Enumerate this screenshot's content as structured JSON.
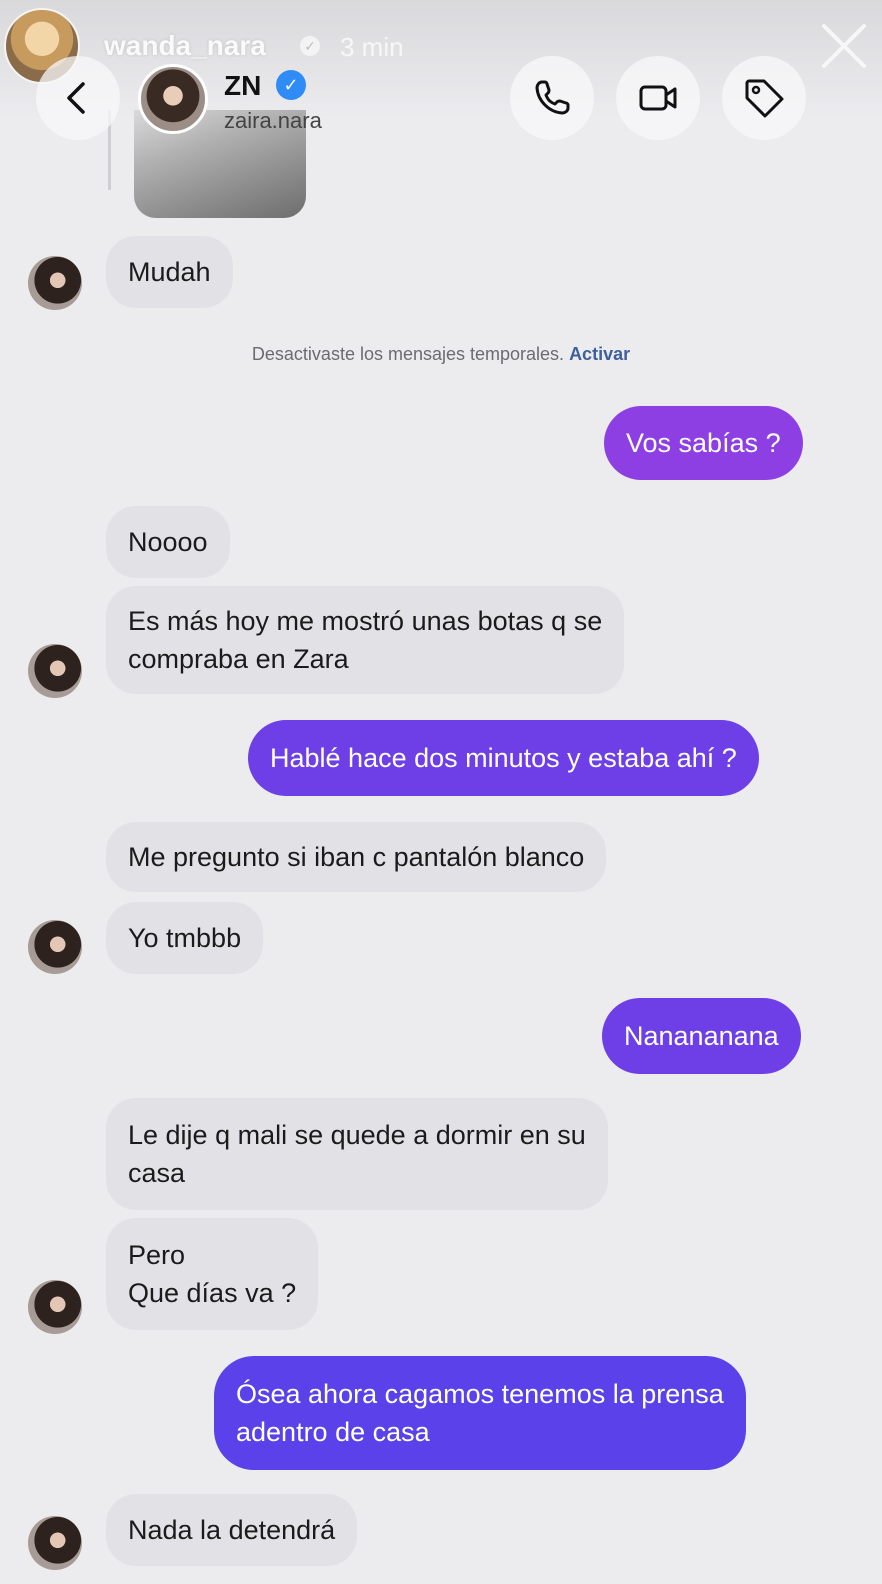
{
  "story": {
    "username": "wanda_nara",
    "time": "3 min"
  },
  "chat_header": {
    "name": "ZN",
    "username": "zaira.nara"
  },
  "system_note": {
    "text": "Desactivaste los mensajes temporales.",
    "action": "Activar"
  },
  "messages": [
    {
      "from": "them",
      "lines": [
        "Mudah"
      ]
    },
    {
      "from": "me",
      "lines": [
        "Vos sabías ?"
      ]
    },
    {
      "from": "them",
      "lines": [
        "Noooo"
      ]
    },
    {
      "from": "them",
      "lines": [
        "Es más hoy me mostró unas botas q se",
        "compraba en Zara"
      ]
    },
    {
      "from": "me",
      "lines": [
        "Hablé hace dos minutos y estaba ahí ?"
      ]
    },
    {
      "from": "them",
      "lines": [
        "Me pregunto si iban c pantalón blanco"
      ]
    },
    {
      "from": "them",
      "lines": [
        "Yo tmbbb"
      ]
    },
    {
      "from": "me",
      "lines": [
        "Nanananana"
      ]
    },
    {
      "from": "them",
      "lines": [
        "Le dije q mali se quede a dormir en su",
        "casa"
      ]
    },
    {
      "from": "them",
      "lines": [
        "Pero",
        "Que días va ?"
      ]
    },
    {
      "from": "me",
      "lines": [
        "Ósea ahora cagamos tenemos la prensa",
        "adentro de casa"
      ]
    },
    {
      "from": "them",
      "lines": [
        "Nada la detendrá"
      ]
    }
  ],
  "colors": {
    "background": "#ececef",
    "incoming_bubble": "#e2e2e6",
    "outgoing_purple": "#8e3fe4",
    "outgoing_violet": "#6e3fe6",
    "outgoing_indigo": "#5b41e9",
    "verified_blue": "#2f8cf6"
  },
  "icons": [
    "close-icon",
    "back-icon",
    "phone-icon",
    "video-camera-icon",
    "tag-icon",
    "verified-icon"
  ]
}
